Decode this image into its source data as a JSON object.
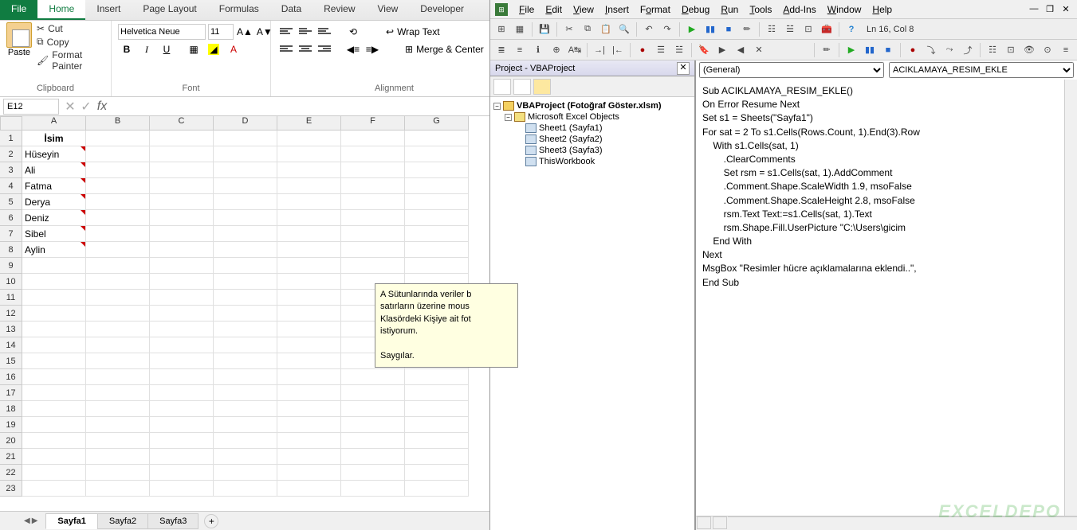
{
  "ribbon": {
    "tabs": [
      "File",
      "Home",
      "Insert",
      "Page Layout",
      "Formulas",
      "Data",
      "Review",
      "View",
      "Developer"
    ],
    "active": "Home",
    "clipboard": {
      "paste": "Paste",
      "cut": "Cut",
      "copy": "Copy",
      "painter": "Format Painter",
      "label": "Clipboard"
    },
    "font": {
      "name": "Helvetica Neue",
      "size": "11",
      "label": "Font"
    },
    "alignment": {
      "wrap": "Wrap Text",
      "merge": "Merge & Center",
      "label": "Alignment"
    }
  },
  "formula_bar": {
    "name_box": "E12",
    "fx": "fx",
    "formula": ""
  },
  "sheet": {
    "columns": [
      "A",
      "B",
      "C",
      "D",
      "E",
      "F",
      "G"
    ],
    "rows": 23,
    "data": {
      "A1": "İsim",
      "A2": "Hüseyin",
      "A3": "Ali",
      "A4": "Fatma",
      "A5": "Derya",
      "A6": "Deniz",
      "A7": "Sibel",
      "A8": "Aylin"
    },
    "comment": "A Sütunlarında veriler b\nsatırların üzerine mous\nKlasördeki Kişiye ait fot\nistiyorum.\n\nSaygılar.",
    "tabs": [
      "Sayfa1",
      "Sayfa2",
      "Sayfa3"
    ],
    "active_tab": "Sayfa1"
  },
  "vbe": {
    "menu": [
      "File",
      "Edit",
      "View",
      "Insert",
      "Format",
      "Debug",
      "Run",
      "Tools",
      "Add-Ins",
      "Window",
      "Help"
    ],
    "status": "Ln 16, Col 8",
    "project": {
      "title": "Project - VBAProject",
      "root": "VBAProject (Fotoğraf Göster.xlsm)",
      "folder": "Microsoft Excel Objects",
      "items": [
        "Sheet1 (Sayfa1)",
        "Sheet2 (Sayfa2)",
        "Sheet3 (Sayfa3)",
        "ThisWorkbook"
      ]
    },
    "code": {
      "object": "(General)",
      "proc": "ACIKLAMAYA_RESIM_EKLE",
      "text": "Sub ACIKLAMAYA_RESIM_EKLE()\nOn Error Resume Next\nSet s1 = Sheets(\"Sayfa1\")\nFor sat = 2 To s1.Cells(Rows.Count, 1).End(3).Row\n    With s1.Cells(sat, 1)\n        .ClearComments\n        Set rsm = s1.Cells(sat, 1).AddComment\n        .Comment.Shape.ScaleWidth 1.9, msoFalse\n        .Comment.Shape.ScaleHeight 2.8, msoFalse\n        rsm.Text Text:=s1.Cells(sat, 1).Text\n        rsm.Shape.Fill.UserPicture \"C:\\Users\\gicim\n    End With\nNext\nMsgBox \"Resimler hücre açıklamalarına eklendi..\",\nEnd Sub"
    }
  },
  "watermark": "EXCELDEPO"
}
